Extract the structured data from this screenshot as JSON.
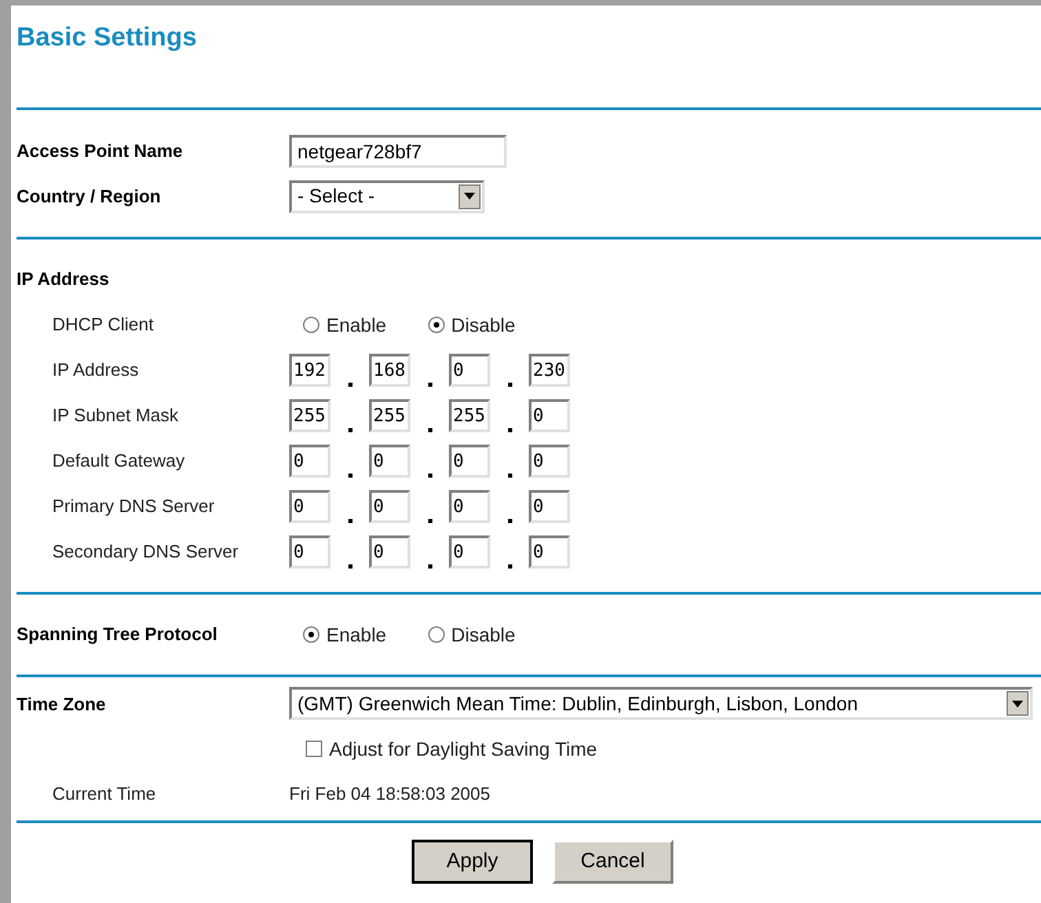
{
  "title": "Basic Settings",
  "sections": [
    {
      "rows": [
        {
          "kind": "text_input",
          "label": "Access Point Name",
          "bold": true,
          "value": "netgear728bf7"
        },
        {
          "kind": "select",
          "label": "Country / Region",
          "bold": true,
          "wide": false,
          "value": "- Select -"
        }
      ]
    },
    {
      "rows": [
        {
          "kind": "heading",
          "label": "IP Address",
          "bold": true
        },
        {
          "kind": "radio",
          "label": "DHCP Client",
          "bold": false,
          "options": [
            {
              "label": "Enable",
              "selected": false
            },
            {
              "label": "Disable",
              "selected": true
            }
          ]
        },
        {
          "kind": "ip",
          "label": "IP Address",
          "bold": false,
          "octets": [
            "192",
            "168",
            "0",
            "230"
          ]
        },
        {
          "kind": "ip",
          "label": "IP Subnet Mask",
          "bold": false,
          "octets": [
            "255",
            "255",
            "255",
            "0"
          ]
        },
        {
          "kind": "ip",
          "label": "Default Gateway",
          "bold": false,
          "octets": [
            "0",
            "0",
            "0",
            "0"
          ]
        },
        {
          "kind": "ip",
          "label": "Primary DNS Server",
          "bold": false,
          "octets": [
            "0",
            "0",
            "0",
            "0"
          ]
        },
        {
          "kind": "ip",
          "label": "Secondary DNS Server",
          "bold": false,
          "octets": [
            "0",
            "0",
            "0",
            "0"
          ]
        }
      ]
    },
    {
      "rows": [
        {
          "kind": "radio",
          "label": "Spanning Tree Protocol",
          "bold": true,
          "options": [
            {
              "label": "Enable",
              "selected": true
            },
            {
              "label": "Disable",
              "selected": false
            }
          ]
        }
      ]
    },
    {
      "rows": [
        {
          "kind": "select",
          "label": "Time Zone",
          "bold": true,
          "wide": true,
          "value": "(GMT) Greenwich Mean Time: Dublin, Edinburgh, Lisbon, London"
        },
        {
          "kind": "checkbox",
          "label": "Adjust for Daylight Saving Time",
          "checked": false
        },
        {
          "kind": "static",
          "label": "Current Time",
          "bold": false,
          "value": "Fri Feb 04 18:58:03 2005"
        }
      ]
    }
  ],
  "buttons": [
    "Apply",
    "Cancel"
  ]
}
